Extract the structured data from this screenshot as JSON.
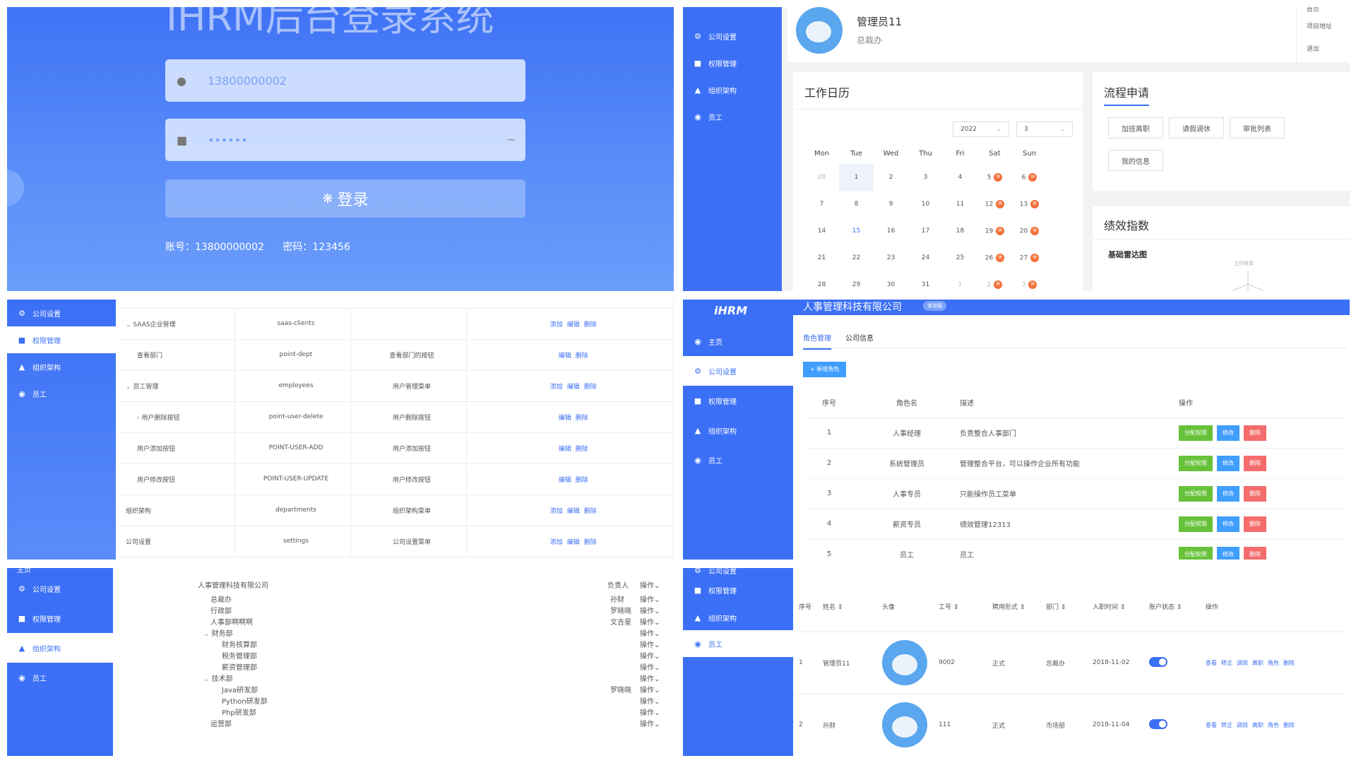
{
  "login": {
    "title": "IHRM后台登录系统",
    "username_value": "13800000002",
    "password_mask": "••••••",
    "login_button": "登录",
    "account_hint": "账号：13800000002",
    "password_hint": "密码：123456"
  },
  "dashboard": {
    "sidebar": [
      "公司设置",
      "权限管理",
      "组织架构",
      "员工"
    ],
    "user_name": "管理员11",
    "user_dept": "总裁办",
    "top_menu": [
      "首页",
      "项目地址",
      "退出"
    ],
    "calendar_title": "工作日历",
    "year": "2022",
    "month": "3",
    "weekdays": [
      "Mon",
      "Tue",
      "Wed",
      "Thu",
      "Fri",
      "Sat",
      "Sun"
    ],
    "weeks": [
      [
        "28",
        "1",
        "2",
        "3",
        "4",
        "5",
        "6"
      ],
      [
        "7",
        "8",
        "9",
        "10",
        "11",
        "12",
        "13"
      ],
      [
        "14",
        "15",
        "16",
        "17",
        "18",
        "19",
        "20"
      ],
      [
        "21",
        "22",
        "23",
        "24",
        "25",
        "26",
        "27"
      ],
      [
        "28",
        "29",
        "30",
        "31",
        "1",
        "2",
        "3"
      ]
    ],
    "rest_badge": "休",
    "process_title": "流程申请",
    "process_buttons": [
      "加班离职",
      "请假调休",
      "审批列表",
      "我的信息"
    ],
    "perf_title": "绩效指数",
    "radar_title": "基础雷达图",
    "radar_label": "工作效率"
  },
  "perm": {
    "sidebar": [
      "公司设置",
      "权限管理",
      "组织架构",
      "员工"
    ],
    "rows": [
      {
        "name": "SAAS企业管理",
        "code": "saas-clients",
        "desc": "",
        "ops": [
          "添加",
          "编辑",
          "删除"
        ],
        "indent": 0,
        "arrow": "⌄"
      },
      {
        "name": "查看部门",
        "code": "point-dept",
        "desc": "查看部门的按钮",
        "ops": [
          "编辑",
          "删除"
        ],
        "indent": 1,
        "arrow": ""
      },
      {
        "name": "员工管理",
        "code": "employees",
        "desc": "用户管理菜单",
        "ops": [
          "添加",
          "编辑",
          "删除"
        ],
        "indent": 0,
        "arrow": "⌄"
      },
      {
        "name": "用户删除按钮",
        "code": "point-user-delete",
        "desc": "用户删除按钮",
        "ops": [
          "编辑",
          "删除"
        ],
        "indent": 1,
        "arrow": "›"
      },
      {
        "name": "用户添加按钮",
        "code": "POINT-USER-ADD",
        "desc": "用户添加按钮",
        "ops": [
          "编辑",
          "删除"
        ],
        "indent": 1,
        "arrow": ""
      },
      {
        "name": "用户修改按钮",
        "code": "POINT-USER-UPDATE",
        "desc": "用户修改按钮",
        "ops": [
          "编辑",
          "删除"
        ],
        "indent": 1,
        "arrow": ""
      },
      {
        "name": "组织架构",
        "code": "departments",
        "desc": "组织架构菜单",
        "ops": [
          "添加",
          "编辑",
          "删除"
        ],
        "indent": 0,
        "arrow": ""
      },
      {
        "name": "公司设置",
        "code": "settings",
        "desc": "公司设置菜单",
        "ops": [
          "添加",
          "编辑",
          "删除"
        ],
        "indent": 0,
        "arrow": ""
      }
    ]
  },
  "roles": {
    "logo": "iHRM",
    "company": "人事管理科技有限公司",
    "badge": "体验版",
    "sidebar": [
      "主页",
      "公司设置",
      "权限管理",
      "组织架构",
      "员工"
    ],
    "tabs": [
      "角色管理",
      "公司信息"
    ],
    "add_button": "+ 新增角色",
    "headers": [
      "序号",
      "角色名",
      "描述",
      "操作"
    ],
    "rows": [
      {
        "id": "1",
        "name": "人事经理",
        "desc": "负责整合人事部门"
      },
      {
        "id": "2",
        "name": "系统管理员",
        "desc": "管理整合平台，可以操作企业所有功能"
      },
      {
        "id": "3",
        "name": "人事专员",
        "desc": "只能操作员工菜单"
      },
      {
        "id": "4",
        "name": "薪资专员",
        "desc": "绩效管理12313"
      },
      {
        "id": "5",
        "name": "员工",
        "desc": "员工"
      }
    ],
    "op_buttons": [
      "分配权限",
      "修改",
      "删除"
    ],
    "colors": {
      "assign": "#67c23a",
      "edit": "#409eff",
      "delete": "#f56c6c"
    }
  },
  "org": {
    "sidebar": [
      "主页",
      "公司设置",
      "权限管理",
      "组织架构",
      "员工"
    ],
    "root": "人事管理科技有限公司",
    "root_head": "负责人",
    "op_label": "操作",
    "nodes": [
      {
        "name": "总裁办",
        "head": "孙财",
        "level": 1,
        "arrow": ""
      },
      {
        "name": "行政部",
        "head": "罗晓晓",
        "level": 1,
        "arrow": ""
      },
      {
        "name": "人事部啊啊啊",
        "head": "文吉星",
        "level": 1,
        "arrow": ""
      },
      {
        "name": "财务部",
        "head": "",
        "level": 1,
        "arrow": "⌄"
      },
      {
        "name": "财务核算部",
        "head": "",
        "level": 2,
        "arrow": ""
      },
      {
        "name": "税务管理部",
        "head": "",
        "level": 2,
        "arrow": ""
      },
      {
        "name": "薪资管理部",
        "head": "",
        "level": 2,
        "arrow": ""
      },
      {
        "name": "技术部",
        "head": "",
        "level": 1,
        "arrow": "⌄"
      },
      {
        "name": "Java研发部",
        "head": "罗晓晓",
        "level": 2,
        "arrow": ""
      },
      {
        "name": "Python研发部",
        "head": "",
        "level": 2,
        "arrow": ""
      },
      {
        "name": "Php研发部",
        "head": "",
        "level": 2,
        "arrow": ""
      },
      {
        "name": "运营部",
        "head": "",
        "level": 1,
        "arrow": ""
      }
    ]
  },
  "emp": {
    "sidebar": [
      "公司设置",
      "权限管理",
      "组织架构",
      "员工"
    ],
    "headers": [
      "序号",
      "姓名 ⇕",
      "头像",
      "工号 ⇕",
      "聘用形式 ⇕",
      "部门 ⇕",
      "入职时间 ⇕",
      "账户状态 ⇕",
      "操作"
    ],
    "rows": [
      {
        "id": "1",
        "name": "管理员11",
        "no": "9002",
        "form": "正式",
        "dept": "总裁办",
        "date": "2018-11-02"
      },
      {
        "id": "2",
        "name": "孙财",
        "no": "111",
        "form": "正式",
        "dept": "市场部",
        "date": "2018-11-04"
      }
    ],
    "ops": [
      "查看",
      "转正",
      "调岗",
      "离职",
      "角色",
      "删除"
    ]
  }
}
